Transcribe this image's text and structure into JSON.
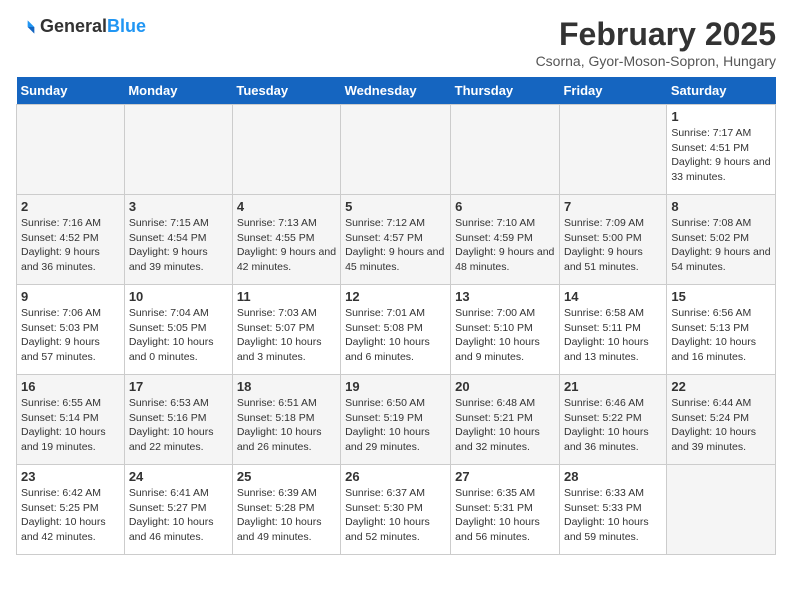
{
  "header": {
    "logo_general": "General",
    "logo_blue": "Blue",
    "title": "February 2025",
    "subtitle": "Csorna, Gyor-Moson-Sopron, Hungary"
  },
  "weekdays": [
    "Sunday",
    "Monday",
    "Tuesday",
    "Wednesday",
    "Thursday",
    "Friday",
    "Saturday"
  ],
  "weeks": [
    [
      {
        "day": "",
        "info": ""
      },
      {
        "day": "",
        "info": ""
      },
      {
        "day": "",
        "info": ""
      },
      {
        "day": "",
        "info": ""
      },
      {
        "day": "",
        "info": ""
      },
      {
        "day": "",
        "info": ""
      },
      {
        "day": "1",
        "info": "Sunrise: 7:17 AM\nSunset: 4:51 PM\nDaylight: 9 hours and 33 minutes."
      }
    ],
    [
      {
        "day": "2",
        "info": "Sunrise: 7:16 AM\nSunset: 4:52 PM\nDaylight: 9 hours and 36 minutes."
      },
      {
        "day": "3",
        "info": "Sunrise: 7:15 AM\nSunset: 4:54 PM\nDaylight: 9 hours and 39 minutes."
      },
      {
        "day": "4",
        "info": "Sunrise: 7:13 AM\nSunset: 4:55 PM\nDaylight: 9 hours and 42 minutes."
      },
      {
        "day": "5",
        "info": "Sunrise: 7:12 AM\nSunset: 4:57 PM\nDaylight: 9 hours and 45 minutes."
      },
      {
        "day": "6",
        "info": "Sunrise: 7:10 AM\nSunset: 4:59 PM\nDaylight: 9 hours and 48 minutes."
      },
      {
        "day": "7",
        "info": "Sunrise: 7:09 AM\nSunset: 5:00 PM\nDaylight: 9 hours and 51 minutes."
      },
      {
        "day": "8",
        "info": "Sunrise: 7:08 AM\nSunset: 5:02 PM\nDaylight: 9 hours and 54 minutes."
      }
    ],
    [
      {
        "day": "9",
        "info": "Sunrise: 7:06 AM\nSunset: 5:03 PM\nDaylight: 9 hours and 57 minutes."
      },
      {
        "day": "10",
        "info": "Sunrise: 7:04 AM\nSunset: 5:05 PM\nDaylight: 10 hours and 0 minutes."
      },
      {
        "day": "11",
        "info": "Sunrise: 7:03 AM\nSunset: 5:07 PM\nDaylight: 10 hours and 3 minutes."
      },
      {
        "day": "12",
        "info": "Sunrise: 7:01 AM\nSunset: 5:08 PM\nDaylight: 10 hours and 6 minutes."
      },
      {
        "day": "13",
        "info": "Sunrise: 7:00 AM\nSunset: 5:10 PM\nDaylight: 10 hours and 9 minutes."
      },
      {
        "day": "14",
        "info": "Sunrise: 6:58 AM\nSunset: 5:11 PM\nDaylight: 10 hours and 13 minutes."
      },
      {
        "day": "15",
        "info": "Sunrise: 6:56 AM\nSunset: 5:13 PM\nDaylight: 10 hours and 16 minutes."
      }
    ],
    [
      {
        "day": "16",
        "info": "Sunrise: 6:55 AM\nSunset: 5:14 PM\nDaylight: 10 hours and 19 minutes."
      },
      {
        "day": "17",
        "info": "Sunrise: 6:53 AM\nSunset: 5:16 PM\nDaylight: 10 hours and 22 minutes."
      },
      {
        "day": "18",
        "info": "Sunrise: 6:51 AM\nSunset: 5:18 PM\nDaylight: 10 hours and 26 minutes."
      },
      {
        "day": "19",
        "info": "Sunrise: 6:50 AM\nSunset: 5:19 PM\nDaylight: 10 hours and 29 minutes."
      },
      {
        "day": "20",
        "info": "Sunrise: 6:48 AM\nSunset: 5:21 PM\nDaylight: 10 hours and 32 minutes."
      },
      {
        "day": "21",
        "info": "Sunrise: 6:46 AM\nSunset: 5:22 PM\nDaylight: 10 hours and 36 minutes."
      },
      {
        "day": "22",
        "info": "Sunrise: 6:44 AM\nSunset: 5:24 PM\nDaylight: 10 hours and 39 minutes."
      }
    ],
    [
      {
        "day": "23",
        "info": "Sunrise: 6:42 AM\nSunset: 5:25 PM\nDaylight: 10 hours and 42 minutes."
      },
      {
        "day": "24",
        "info": "Sunrise: 6:41 AM\nSunset: 5:27 PM\nDaylight: 10 hours and 46 minutes."
      },
      {
        "day": "25",
        "info": "Sunrise: 6:39 AM\nSunset: 5:28 PM\nDaylight: 10 hours and 49 minutes."
      },
      {
        "day": "26",
        "info": "Sunrise: 6:37 AM\nSunset: 5:30 PM\nDaylight: 10 hours and 52 minutes."
      },
      {
        "day": "27",
        "info": "Sunrise: 6:35 AM\nSunset: 5:31 PM\nDaylight: 10 hours and 56 minutes."
      },
      {
        "day": "28",
        "info": "Sunrise: 6:33 AM\nSunset: 5:33 PM\nDaylight: 10 hours and 59 minutes."
      },
      {
        "day": "",
        "info": ""
      }
    ]
  ]
}
